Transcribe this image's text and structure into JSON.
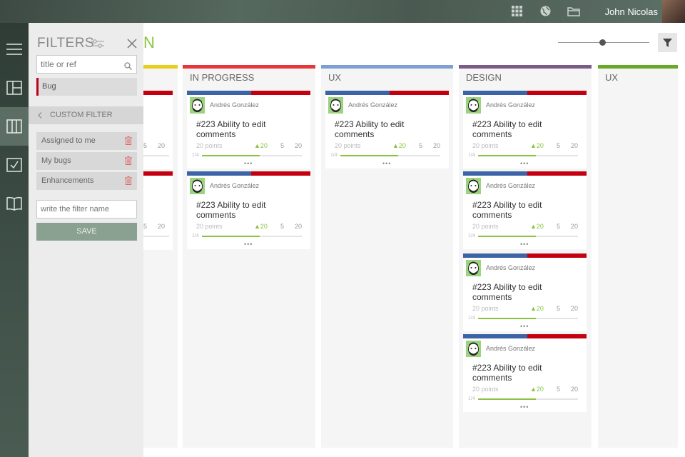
{
  "topbar": {
    "user_name": "John Nicolas",
    "icons": [
      "grid-icon",
      "globe-icon",
      "folder-icon"
    ]
  },
  "nav": {
    "items": [
      "menu-icon",
      "layout-icon",
      "kanban-icon",
      "checklist-icon",
      "book-icon"
    ],
    "active": "kanban-icon"
  },
  "filters": {
    "title": "FILTERS",
    "search_placeholder": "title or ref",
    "applied_tag": "Bug",
    "custom_filter_label": "CUSTOM FILTER",
    "custom_filters": [
      "Assigned to me",
      "My bugs",
      "Enhancements"
    ],
    "name_placeholder": "write the filter name",
    "save_label": "SAVE"
  },
  "board": {
    "title_fragment": "N",
    "slider_value": 0.45,
    "columns": [
      {
        "title": "IN PROGRESS",
        "color": "#e5373c"
      },
      {
        "title": "UX",
        "color": "#7d9fd1"
      },
      {
        "title": "DESIGN",
        "color": "#7a5b8a"
      },
      {
        "title": "UX",
        "color": "#68a92a"
      }
    ],
    "hidden_column_color": "#e8cf1a",
    "card": {
      "author": "Andrés González",
      "title": "#223 Ability to edit comments",
      "points": "20 points",
      "up_count": "▲20",
      "count_a": "5",
      "count_b": "20",
      "fraction": "1/4",
      "progress": 0.58,
      "more": "•••"
    },
    "partial_values": {
      "a": "5",
      "b": "20"
    }
  },
  "colors": {
    "accent": "#8ac43f",
    "bug": "#c40010",
    "story": "#3c63a6"
  }
}
